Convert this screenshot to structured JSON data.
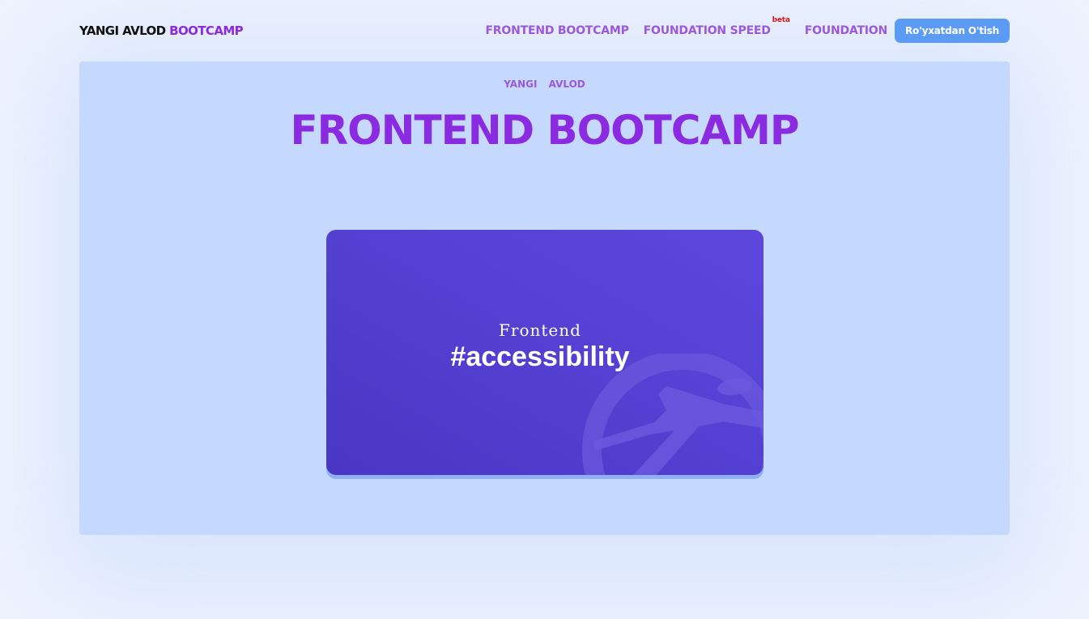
{
  "header": {
    "logo_part1": "YANGI AVLOD",
    "logo_part2": "BOOTCAMP",
    "nav": [
      {
        "label": "FRONTEND BOOTCAMP"
      },
      {
        "label": "FOUNDATION SPEED",
        "badge": "beta"
      },
      {
        "label": "FOUNDATION"
      }
    ],
    "register_label": "Ro'yxatdan O'tish"
  },
  "hero": {
    "breadcrumb": [
      "YANGI",
      "AVLOD"
    ],
    "title": "FRONTEND BOOTCAMP",
    "card": {
      "subtitle": "Frontend",
      "headline": "#accessibility",
      "icon": "accessibility-icon"
    }
  },
  "colors": {
    "accent": "#8a2be2",
    "nav": "#9b59d9",
    "button": "#5b9bf6",
    "hero_bg": "#c5d8fe",
    "card": "#5441d3",
    "beta": "#e0151b"
  }
}
